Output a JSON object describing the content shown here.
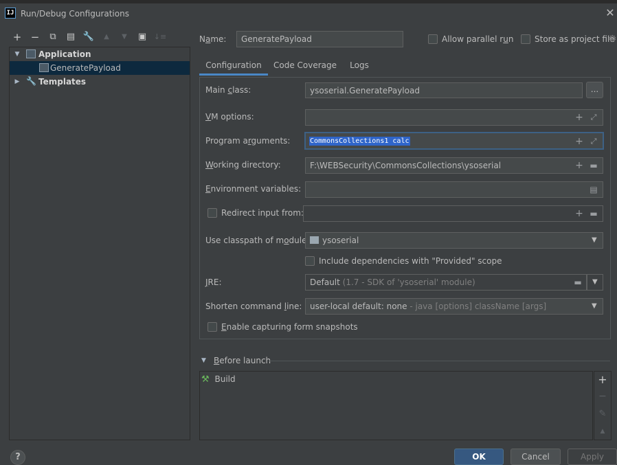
{
  "window": {
    "title": "Run/Debug Configurations",
    "app_icon_text": "IJ"
  },
  "toolbar": {
    "add": "+",
    "remove": "−",
    "copy": "⧉",
    "save": "▤",
    "edit_defaults": "🔧",
    "move_up": "▲",
    "move_down": "▼",
    "move_to_group": "▣",
    "sort": "↓≡"
  },
  "tree": {
    "application": "Application",
    "config": "GeneratePayload",
    "templates": "Templates"
  },
  "header": {
    "name_label_pre": "N",
    "name_label_u": "a",
    "name_label_post": "me:",
    "name_value": "GeneratePayload",
    "allow_parallel_pre": "Allow parallel r",
    "allow_parallel_u": "u",
    "allow_parallel_post": "n",
    "store_project": "Store as project file"
  },
  "tabs": [
    "Configuration",
    "Code Coverage",
    "Logs"
  ],
  "form": {
    "main_class_pre": "Main ",
    "main_class_u": "c",
    "main_class_post": "lass:",
    "main_class_value": "ysoserial.GeneratePayload",
    "browse": "...",
    "vm_u": "V",
    "vm_post": "M options:",
    "vm_value": "",
    "prog_pre": "Program a",
    "prog_u": "r",
    "prog_post": "guments:",
    "prog_value": "CommonsCollections1 calc",
    "wd_u": "W",
    "wd_post": "orking directory:",
    "wd_value": "F:\\WEBSecurity\\CommonsCollections\\ysoserial",
    "env_u": "E",
    "env_post": "nvironment variables:",
    "env_value": "",
    "redirect": "Redirect input from:",
    "redirect_value": "",
    "cp_pre": "Use classpath of m",
    "cp_u": "o",
    "cp_post": "dule:",
    "cp_value": "ysoserial",
    "include_deps": "Include dependencies with \"Provided\" scope",
    "jre_u": "J",
    "jre_post": "RE:",
    "jre_value_main": "Default",
    "jre_value_hint": " (1.7 - SDK of 'ysoserial' module)",
    "shorten_pre": "Shorten command ",
    "shorten_u": "l",
    "shorten_post": "ine:",
    "shorten_main": "user-local default: none",
    "shorten_hint": " - java [options] className [args]",
    "enable_snap_u": "E",
    "enable_snap_post": "nable capturing form snapshots"
  },
  "before_launch": {
    "header_u": "B",
    "header_post": "efore launch",
    "items": [
      "Build"
    ],
    "add": "+",
    "remove": "−",
    "edit": "✎",
    "up": "▲"
  },
  "footer": {
    "help": "?",
    "ok": "OK",
    "cancel": "Cancel",
    "apply": "Apply"
  },
  "colors": {
    "accent": "#4a88c7",
    "selection": "#2f65ca",
    "ok_button": "#365880"
  }
}
